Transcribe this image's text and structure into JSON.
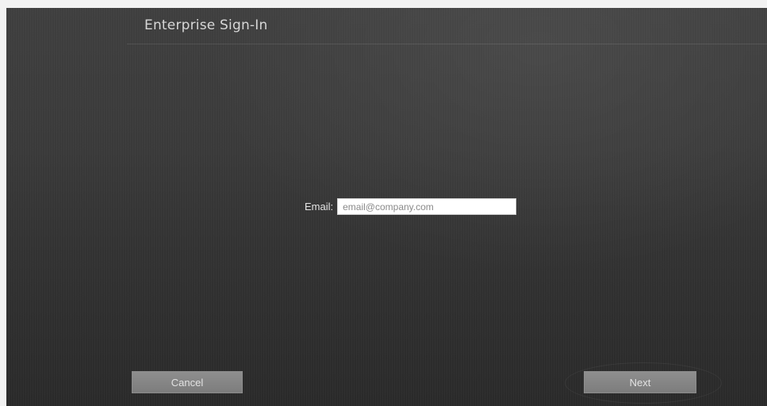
{
  "window": {
    "title": "Enterprise Sign-In"
  },
  "form": {
    "email_label": "Email:",
    "email_placeholder": "email@company.com",
    "email_value": ""
  },
  "buttons": {
    "cancel_label": "Cancel",
    "next_label": "Next"
  },
  "colors": {
    "background": "#3a3a3a",
    "button": "#858585",
    "title_text": "#d7d7d7"
  }
}
